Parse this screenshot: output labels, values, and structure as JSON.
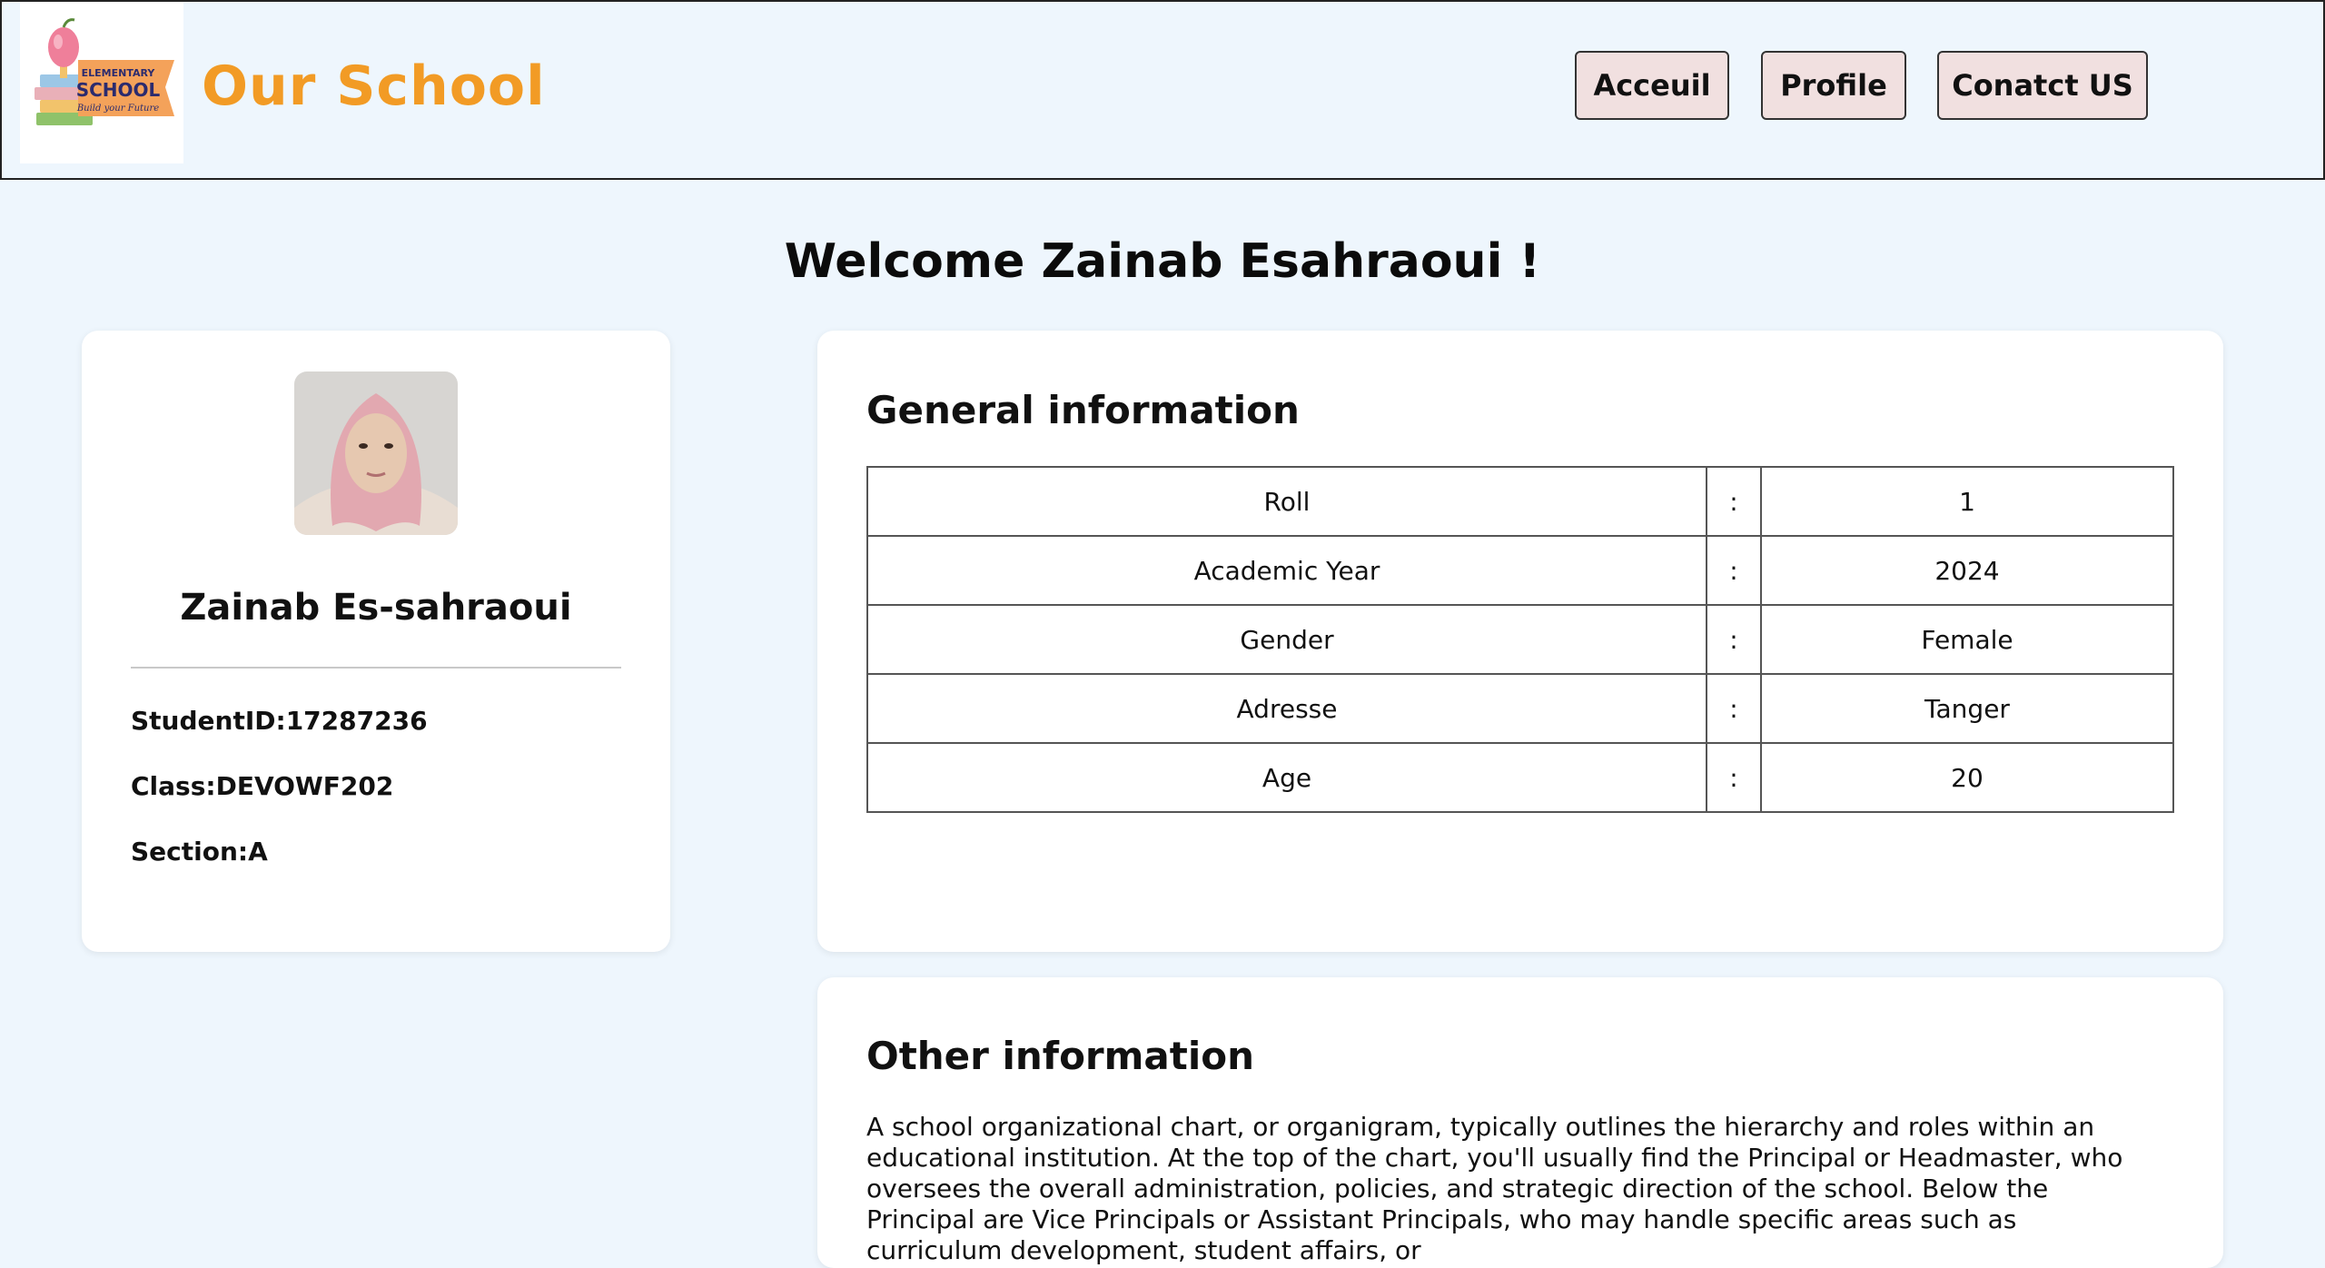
{
  "header": {
    "logo": {
      "text_line1": "ELEMENTARY",
      "text_line2": "SCHOOL",
      "text_line3": "Build your Future"
    },
    "brand": "Our School",
    "nav": [
      {
        "label": "Acceuil"
      },
      {
        "label": "Profile"
      },
      {
        "label": "Conatct US"
      }
    ]
  },
  "welcome": "Welcome Zainab Esahraoui !",
  "profile": {
    "name": "Zainab Es-sahraoui",
    "student_id": "StudentID:17287236",
    "class": "Class:DEVOWF202",
    "section": "Section:A"
  },
  "general": {
    "title": "General information",
    "rows": [
      {
        "label": "Roll",
        "sep": ":",
        "value": "1"
      },
      {
        "label": "Academic Year",
        "sep": ":",
        "value": "2024"
      },
      {
        "label": "Gender",
        "sep": ":",
        "value": "Female"
      },
      {
        "label": "Adresse",
        "sep": ":",
        "value": "Tanger"
      },
      {
        "label": "Age",
        "sep": ":",
        "value": "20"
      }
    ]
  },
  "other": {
    "title": "Other information",
    "text": "A school organizational chart, or organigram, typically outlines the hierarchy and roles within an educational institution. At the top of the chart, you'll usually find the Principal or Headmaster, who oversees the overall administration, policies, and strategic direction of the school. Below the Principal are Vice Principals or Assistant Principals, who may handle specific areas such as curriculum development, student affairs, or"
  },
  "colors": {
    "brand": "#f29b25",
    "background": "#eef6fd",
    "nav_button": "#f1e0e0"
  }
}
